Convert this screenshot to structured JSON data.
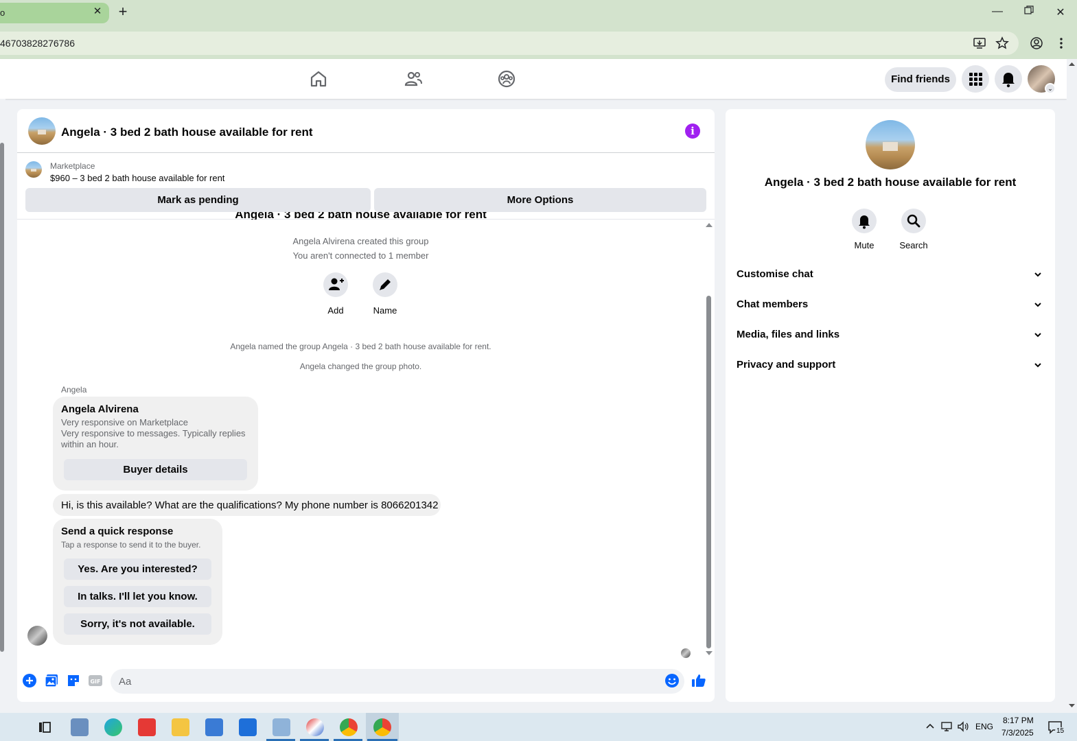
{
  "browser": {
    "tab_title": "o",
    "url_fragment": "46703828276786"
  },
  "fbnav": {
    "find_friends": "Find friends"
  },
  "chat": {
    "header_title": "Angela · 3 bed 2 bath house available for rent",
    "marketplace_label": "Marketplace",
    "listing_title": "$960 – 3 bed 2 bath house available for rent",
    "mark_pending": "Mark as pending",
    "more_options": "More Options",
    "intro_title": "Angela · 3 bed 2 bath house available for rent",
    "created_by": "Angela Alvirena created this group",
    "connection_note": "You aren't connected to 1 member",
    "actions": [
      {
        "label": "Add",
        "icon": "add-person-icon"
      },
      {
        "label": "Name",
        "icon": "pencil-icon"
      }
    ],
    "event_named": "Angela named the group Angela · 3 bed 2 bath house available for rent.",
    "event_photo": "Angela changed the group photo.",
    "sender": "Angela",
    "card": {
      "name": "Angela Alvirena",
      "line1": "Very responsive on Marketplace",
      "line2": "Very responsive to messages. Typically replies within an hour.",
      "button": "Buyer details"
    },
    "message": "Hi, is this available? What are the qualifications? My phone number is 8066201342",
    "quick": {
      "title": "Send a quick response",
      "subtitle": "Tap a response to send it to the buyer.",
      "options": [
        "Yes. Are you interested?",
        "In talks. I'll let you know.",
        "Sorry, it's not available."
      ]
    },
    "composer_placeholder": "Aa"
  },
  "right_panel": {
    "title": "Angela · 3 bed 2 bath house available for rent",
    "actions": [
      {
        "label": "Mute",
        "icon": "bell-icon"
      },
      {
        "label": "Search",
        "icon": "search-icon"
      }
    ],
    "sections": [
      "Customise chat",
      "Chat members",
      "Media, files and links",
      "Privacy and support"
    ]
  },
  "taskbar": {
    "lang": "ENG",
    "time": "8:17 PM",
    "date": "7/3/2025",
    "notif_count": "15"
  },
  "colors": {
    "accent_blue": "#0866ff",
    "info_purple": "#a020f0",
    "bubble_gray": "#f0f0f0"
  }
}
